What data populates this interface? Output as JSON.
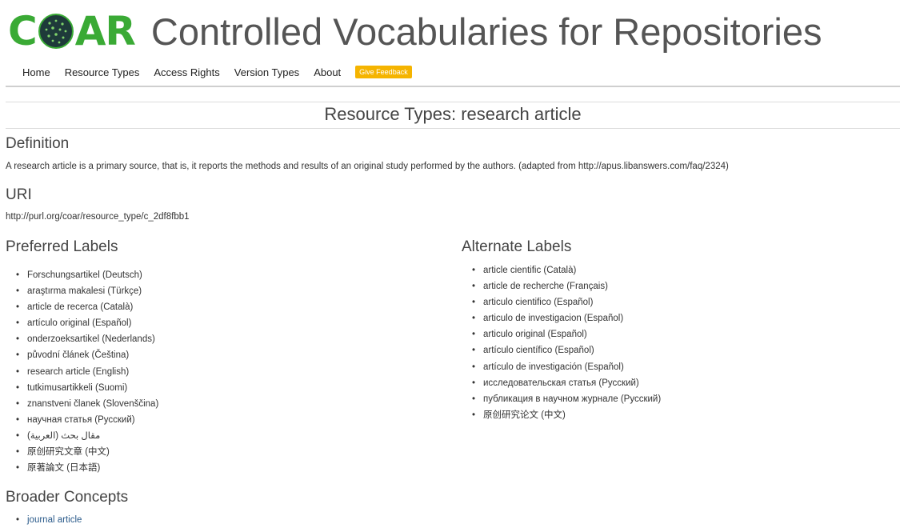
{
  "header": {
    "logo_text_left": "C",
    "logo_text_right": "AR",
    "site_title": "Controlled Vocabularies for Repositories",
    "brand_color": "#3aaa35"
  },
  "nav": {
    "items": [
      "Home",
      "Resource Types",
      "Access Rights",
      "Version Types",
      "About"
    ],
    "feedback_label": "Give Feedback",
    "feedback_color": "#f5b400"
  },
  "page": {
    "title": "Resource Types: research article"
  },
  "definition": {
    "heading": "Definition",
    "text": "A research article is a primary source, that is, it reports the methods and results of an original study performed by the authors. (adapted from http://apus.libanswers.com/faq/2324)"
  },
  "uri": {
    "heading": "URI",
    "value": "http://purl.org/coar/resource_type/c_2df8fbb1"
  },
  "preferred_labels": {
    "heading": "Preferred Labels",
    "items": [
      "Forschungsartikel (Deutsch)",
      "araştırma makalesi (Türkçe)",
      "article de recerca (Català)",
      "artículo original (Español)",
      "onderzoeksartikel (Nederlands)",
      "původní článek (Čeština)",
      "research article (English)",
      "tutkimusartikkeli (Suomi)",
      "znanstveni članek (Slovenščina)",
      "научная статья (Русский)",
      "مقال بحث (العربية)",
      "原创研究文章 (中文)",
      "原著論文 (日本語)"
    ]
  },
  "alternate_labels": {
    "heading": "Alternate Labels",
    "items": [
      "article cientific (Català)",
      "article de recherche (Français)",
      "articulo cientifico (Español)",
      "articulo de investigacion (Español)",
      "articulo original (Español)",
      "artículo científico (Español)",
      "artículo de investigación (Español)",
      "исследовательская статья (Русский)",
      "публикация в научном журнале (Русский)",
      "原创研究论文 (中文)"
    ]
  },
  "broader_concepts": {
    "heading": "Broader Concepts",
    "items": [
      "journal article"
    ]
  }
}
